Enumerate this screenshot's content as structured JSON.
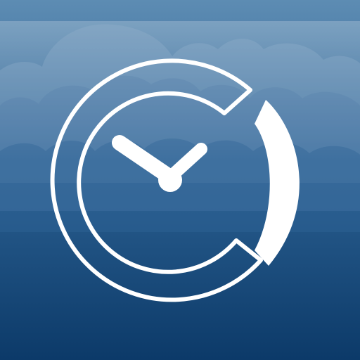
{
  "icon": {
    "name": "clock-app-icon",
    "depicts": [
      "cloud-icon",
      "clock-icon",
      "c-logo-icon"
    ]
  },
  "colors": {
    "sky_top": "#5d8cb3",
    "sky_mid": "#2d6293",
    "sky_bottom": "#0c3a69",
    "cloud_light": "#8fb0cb",
    "cloud_mid": "#6b93b8",
    "cloud_dark": "#4a79a5",
    "glyph": "#ffffff"
  }
}
